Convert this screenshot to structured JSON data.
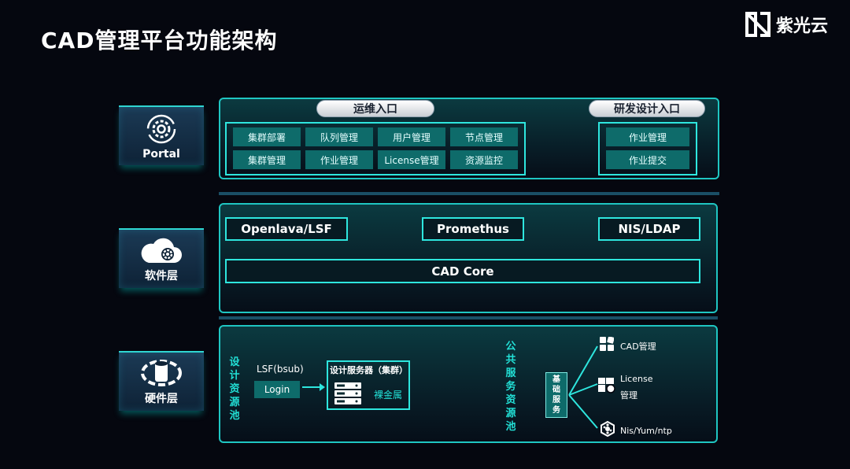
{
  "page": {
    "title": "CAD管理平台功能架构",
    "brand": "紫光云"
  },
  "layers": {
    "portal": {
      "label": "Portal"
    },
    "software": {
      "label": "软件层"
    },
    "hardware": {
      "label": "硬件层"
    }
  },
  "portal": {
    "ops_title": "运维入口",
    "ops_items": [
      "集群部署",
      "队列管理",
      "用户管理",
      "节点管理",
      "集群管理",
      "作业管理",
      "License管理",
      "资源监控"
    ],
    "dev_title": "研发设计入口",
    "dev_items": [
      "作业管理",
      "作业提交"
    ]
  },
  "software": {
    "openlava": "Openlava/LSF",
    "promethus": "Promethus",
    "nis": "NIS/LDAP",
    "core": "CAD Core"
  },
  "hardware": {
    "design_pool": "设计资源池",
    "lsf": "LSF(bsub)",
    "login": "Login",
    "server_title": "设计服务器（集群）",
    "bare_metal": "裸金属",
    "public_pool": "公共服务资源池",
    "basic_service": "基础服务",
    "services": {
      "cad": "CAD管理",
      "license_line1": "License",
      "license_line2": "管理",
      "nis": "Nis/Yum/ntp"
    }
  },
  "colors": {
    "accent": "#2ee6de",
    "cell": "#0e6b6a",
    "background": "#05070f"
  }
}
